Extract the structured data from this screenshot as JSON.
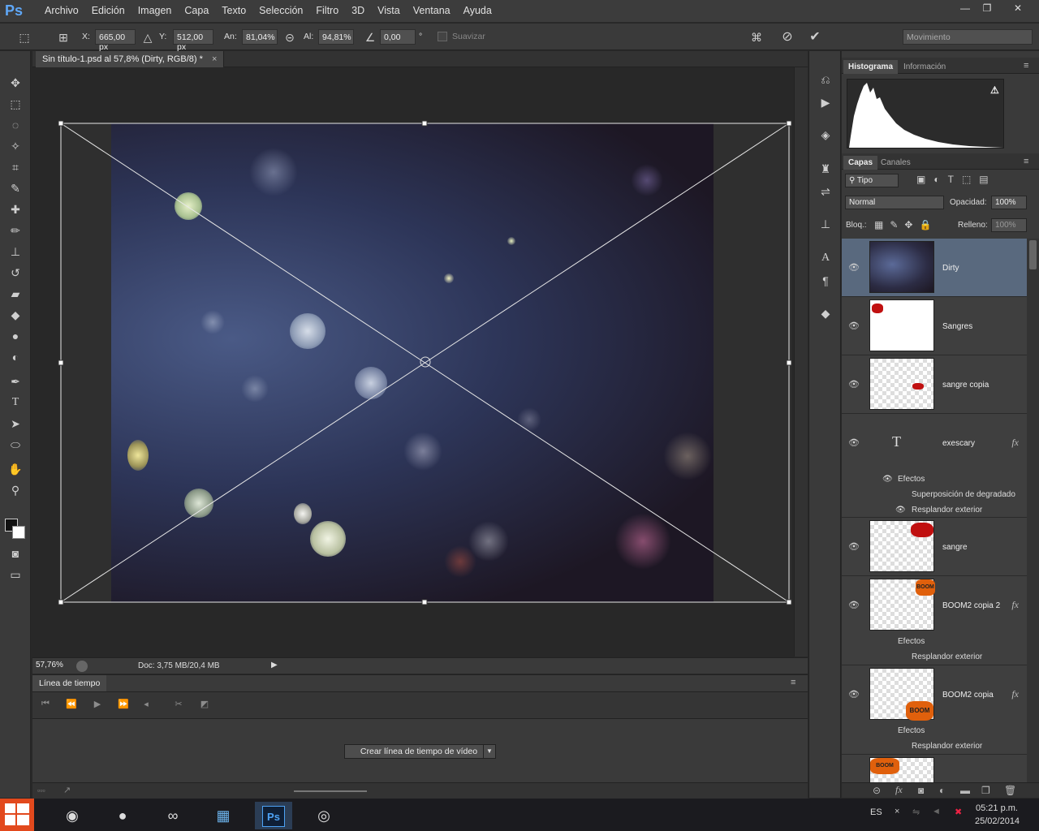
{
  "app": {
    "logo": "Ps",
    "menus": [
      "Archivo",
      "Edición",
      "Imagen",
      "Capa",
      "Texto",
      "Selección",
      "Filtro",
      "3D",
      "Vista",
      "Ventana",
      "Ayuda"
    ]
  },
  "options_bar": {
    "x_label": "X:",
    "x_value": "665,00 px",
    "y_label": "Y:",
    "y_value": "512,00 px",
    "w_label": "An:",
    "w_value": "81,04%",
    "h_label": "Al:",
    "h_value": "94,81%",
    "angle_value": "0,00",
    "angle_unit": "°",
    "smooth_label": "Suavizar",
    "preset_value": "Movimiento"
  },
  "document": {
    "tab_title": "Sin título-1.psd al 57,8% (Dirty, RGB/8) *",
    "zoom": "57,76%",
    "doc_info": "Doc: 3,75 MB/20,4 MB"
  },
  "timeline": {
    "tab": "Línea de tiempo",
    "create_button": "Crear línea de tiempo de vídeo"
  },
  "histogram_panel": {
    "tabs": [
      "Histograma",
      "Información"
    ]
  },
  "layers_panel": {
    "tabs": [
      "Capas",
      "Canales"
    ],
    "filter_label": "Tipo",
    "blend_mode": "Normal",
    "opacity_label": "Opacidad:",
    "opacity_value": "100%",
    "lock_label": "Bloq.:",
    "fill_label": "Relleno:",
    "fill_value": "100%",
    "layers": [
      {
        "name": "Dirty"
      },
      {
        "name": "Sangres"
      },
      {
        "name": "sangre copia"
      },
      {
        "name": "exescary",
        "effects_label": "Efectos",
        "effects": [
          "Superposición de degradado",
          "Resplandor exterior"
        ]
      },
      {
        "name": "sangre"
      },
      {
        "name": "BOOM2 copia 2",
        "effects_label": "Efectos",
        "effects": [
          "Resplandor exterior"
        ]
      },
      {
        "name": "BOOM2 copia",
        "effects_label": "Efectos",
        "effects": [
          "Resplandor exterior"
        ]
      }
    ],
    "fx_label": "fx",
    "type_glyph": "T",
    "thumb_boom": "BOOM"
  },
  "taskbar": {
    "lang": "ES",
    "time": "05:21 p.m.",
    "date": "25/02/2014"
  }
}
